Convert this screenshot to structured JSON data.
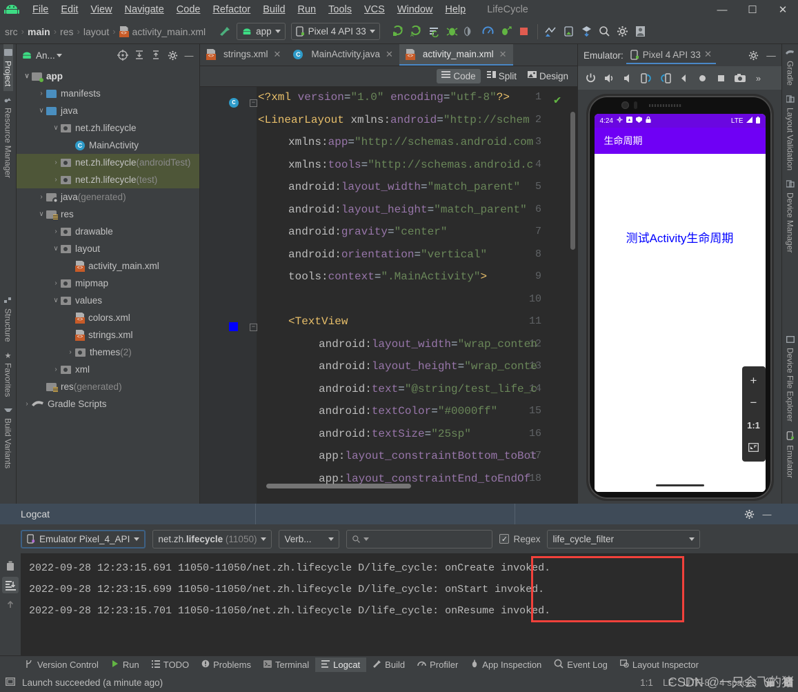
{
  "window": {
    "project_title": "LifeCycle",
    "minimize": "—",
    "maximize": "☐",
    "close": "✕"
  },
  "menu": {
    "items": [
      "File",
      "Edit",
      "View",
      "Navigate",
      "Code",
      "Refactor",
      "Build",
      "Run",
      "Tools",
      "VCS",
      "Window",
      "Help"
    ]
  },
  "navbar": {
    "breadcrumbs": [
      "src",
      "main",
      "res",
      "layout",
      "activity_main.xml"
    ],
    "separator": "›",
    "run_config": "app",
    "device": "Pixel 4 API 33",
    "icons": [
      "run-icon",
      "debug-run-icon",
      "apply-changes-icon",
      "debug-icon",
      "run-step-icon",
      "profiler-icon",
      "attach-debugger-icon",
      "stop-icon",
      "sdk-manager-icon",
      "avd-manager-icon",
      "sync-gradle-icon",
      "search-icon",
      "settings-icon",
      "account-icon"
    ]
  },
  "left_rail": {
    "items": [
      {
        "label": "Project",
        "icon": "project-icon",
        "selected": true
      },
      {
        "label": "Resource Manager",
        "icon": "resource-icon",
        "selected": false
      },
      {
        "label": "Structure",
        "icon": "structure-icon",
        "selected": false
      },
      {
        "label": "Favorites",
        "icon": "star-icon",
        "selected": false
      },
      {
        "label": "Build Variants",
        "icon": "variants-icon",
        "selected": false
      }
    ]
  },
  "right_rail": {
    "items": [
      {
        "label": "Gradle",
        "icon": "gradle-icon"
      },
      {
        "label": "Layout Validation",
        "icon": "layout-validation-icon"
      },
      {
        "label": "Device Manager",
        "icon": "device-manager-icon"
      },
      {
        "label": "Device File Explorer",
        "icon": "device-file-explorer-icon"
      },
      {
        "label": "Emulator",
        "icon": "emulator-icon"
      }
    ]
  },
  "project_panel": {
    "title": "An...",
    "tree": [
      {
        "indent": 0,
        "arrow": "∨",
        "icon": "folder-module",
        "label": "app",
        "suffix": "",
        "bold": true,
        "highlight": false
      },
      {
        "indent": 1,
        "arrow": "›",
        "icon": "folder-blue",
        "label": "manifests",
        "suffix": "",
        "bold": false,
        "highlight": false
      },
      {
        "indent": 1,
        "arrow": "∨",
        "icon": "folder-blue",
        "label": "java",
        "suffix": "",
        "bold": false,
        "highlight": false
      },
      {
        "indent": 2,
        "arrow": "∨",
        "icon": "package",
        "label": "net.zh.lifecycle",
        "suffix": "",
        "bold": false,
        "highlight": false
      },
      {
        "indent": 3,
        "arrow": "",
        "icon": "class",
        "label": "MainActivity",
        "suffix": "",
        "bold": false,
        "highlight": false
      },
      {
        "indent": 2,
        "arrow": "›",
        "icon": "package",
        "label": "net.zh.lifecycle",
        "suffix": " (androidTest)",
        "bold": false,
        "highlight": true
      },
      {
        "indent": 2,
        "arrow": "›",
        "icon": "package",
        "label": "net.zh.lifecycle",
        "suffix": " (test)",
        "bold": false,
        "highlight": true
      },
      {
        "indent": 1,
        "arrow": "›",
        "icon": "folder-generated",
        "label": "java",
        "suffix": " (generated)",
        "bold": false,
        "highlight": false
      },
      {
        "indent": 1,
        "arrow": "∨",
        "icon": "folder-res",
        "label": "res",
        "suffix": "",
        "bold": false,
        "highlight": false
      },
      {
        "indent": 2,
        "arrow": "›",
        "icon": "package",
        "label": "drawable",
        "suffix": "",
        "bold": false,
        "highlight": false
      },
      {
        "indent": 2,
        "arrow": "∨",
        "icon": "package",
        "label": "layout",
        "suffix": "",
        "bold": false,
        "highlight": false
      },
      {
        "indent": 3,
        "arrow": "",
        "icon": "xml-file",
        "label": "activity_main.xml",
        "suffix": "",
        "bold": false,
        "highlight": false
      },
      {
        "indent": 2,
        "arrow": "›",
        "icon": "package",
        "label": "mipmap",
        "suffix": "",
        "bold": false,
        "highlight": false
      },
      {
        "indent": 2,
        "arrow": "∨",
        "icon": "package",
        "label": "values",
        "suffix": "",
        "bold": false,
        "highlight": false
      },
      {
        "indent": 3,
        "arrow": "",
        "icon": "xml-file",
        "label": "colors.xml",
        "suffix": "",
        "bold": false,
        "highlight": false
      },
      {
        "indent": 3,
        "arrow": "",
        "icon": "xml-file",
        "label": "strings.xml",
        "suffix": "",
        "bold": false,
        "highlight": false
      },
      {
        "indent": 3,
        "arrow": "›",
        "icon": "package",
        "label": "themes",
        "suffix": " (2)",
        "bold": false,
        "highlight": false
      },
      {
        "indent": 2,
        "arrow": "›",
        "icon": "package",
        "label": "xml",
        "suffix": "",
        "bold": false,
        "highlight": false
      },
      {
        "indent": 1,
        "arrow": "",
        "icon": "folder-res",
        "label": "res",
        "suffix": " (generated)",
        "bold": false,
        "highlight": false
      },
      {
        "indent": 0,
        "arrow": "›",
        "icon": "gradle",
        "label": "Gradle Scripts",
        "suffix": "",
        "bold": false,
        "highlight": false
      }
    ]
  },
  "editor": {
    "tabs": [
      {
        "label": "strings.xml",
        "icon": "xml-file-icon",
        "active": false
      },
      {
        "label": "MainActivity.java",
        "icon": "java-class-icon",
        "active": false
      },
      {
        "label": "activity_main.xml",
        "icon": "xml-file-icon",
        "active": true
      }
    ],
    "modes": [
      {
        "label": "Code",
        "selected": true
      },
      {
        "label": "Split",
        "selected": false
      },
      {
        "label": "Design",
        "selected": false
      }
    ],
    "lines": [
      {
        "n": "1",
        "html": "<span class='k-tag'>&lt;?xml</span> <span class='k-attr'>version</span><span class='k-plain'>=</span><span class='k-str'>\"1.0\"</span> <span class='k-attr'>encoding</span><span class='k-plain'>=</span><span class='k-str'>\"utf-8\"</span><span class='k-tag'>?&gt;</span>",
        "indent": 0
      },
      {
        "n": "2",
        "html": "<span class='k-tag'>&lt;LinearLayout</span> <span class='k-ns'>xmlns:</span><span class='k-attr'>android</span><span class='k-plain'>=</span><span class='k-str'>\"http://schem</span>",
        "indent": 0
      },
      {
        "n": "3",
        "html": "<span class='k-ns'>xmlns:</span><span class='k-attr'>app</span><span class='k-plain'>=</span><span class='k-str'>\"http://schemas.android.com</span>",
        "indent": 1
      },
      {
        "n": "4",
        "html": "<span class='k-ns'>xmlns:</span><span class='k-attr'>tools</span><span class='k-plain'>=</span><span class='k-str'>\"http://schemas.android.c</span>",
        "indent": 1
      },
      {
        "n": "5",
        "html": "<span class='k-ns'>android:</span><span class='k-attr'>layout_width</span><span class='k-plain'>=</span><span class='k-str'>\"match_parent\"</span>",
        "indent": 1
      },
      {
        "n": "6",
        "html": "<span class='k-ns'>android:</span><span class='k-attr'>layout_height</span><span class='k-plain'>=</span><span class='k-str'>\"match_parent\"</span>",
        "indent": 1
      },
      {
        "n": "7",
        "html": "<span class='k-ns'>android:</span><span class='k-attr'>gravity</span><span class='k-plain'>=</span><span class='k-str'>\"center\"</span>",
        "indent": 1
      },
      {
        "n": "8",
        "html": "<span class='k-ns'>android:</span><span class='k-attr'>orientation</span><span class='k-plain'>=</span><span class='k-str'>\"vertical\"</span>",
        "indent": 1
      },
      {
        "n": "9",
        "html": "<span class='k-ns'>tools:</span><span class='k-attr'>context</span><span class='k-plain'>=</span><span class='k-str'>\".MainActivity\"</span><span class='k-tag'>&gt;</span>",
        "indent": 1
      },
      {
        "n": "10",
        "html": "",
        "indent": 0
      },
      {
        "n": "11",
        "html": "<span class='k-tag'>&lt;TextView</span>",
        "indent": 1
      },
      {
        "n": "12",
        "html": "<span class='k-ns'>android:</span><span class='k-attr'>layout_width</span><span class='k-plain'>=</span><span class='k-str'>\"wrap_conten</span>",
        "indent": 2
      },
      {
        "n": "13",
        "html": "<span class='k-ns'>android:</span><span class='k-attr'>layout_height</span><span class='k-plain'>=</span><span class='k-str'>\"wrap_conte</span>",
        "indent": 2
      },
      {
        "n": "14",
        "html": "<span class='k-ns'>android:</span><span class='k-attr'>text</span><span class='k-plain'>=</span><span class='k-str'>\"@string/test_life_c</span>",
        "indent": 2
      },
      {
        "n": "15",
        "html": "<span class='k-ns'>android:</span><span class='k-attr'>textColor</span><span class='k-plain'>=</span><span class='k-str'>\"#0000ff\"</span>",
        "indent": 2
      },
      {
        "n": "16",
        "html": "<span class='k-ns'>android:</span><span class='k-attr'>textSize</span><span class='k-plain'>=</span><span class='k-str'>\"25sp\"</span>",
        "indent": 2
      },
      {
        "n": "17",
        "html": "<span class='k-ns'>app:</span><span class='k-attr'>layout_constraintBottom_toBot</span>",
        "indent": 2
      },
      {
        "n": "18",
        "html": "<span class='k-ns'>app:</span><span class='k-attr'>layout_constraintEnd_toEndOf</span>",
        "indent": 2
      }
    ]
  },
  "emulator": {
    "label": "Emulator:",
    "tab": "Pixel 4 API 33",
    "toolbar_icons": [
      "power-icon",
      "volume-up-icon",
      "volume-down-icon",
      "rotate-left-icon",
      "rotate-right-icon",
      "back-icon",
      "home-icon",
      "overview-icon",
      "screenshot-icon",
      "more-icon"
    ],
    "device": {
      "status_time": "4:24",
      "status_right": "LTE",
      "app_bar_title": "生命周期",
      "screen_text": "测试Activity生命周期",
      "screen_text_color": "#0000ff",
      "app_bar_color": "#6f00f5"
    },
    "zoom_controls": [
      "+",
      "−",
      "1:1",
      "⛶"
    ]
  },
  "logcat": {
    "title": "Logcat",
    "device_filter": "Emulator Pixel_4_API",
    "process_filter_prefix": "net.zh.",
    "process_filter_bold": "lifecycle",
    "process_filter_pid": "(11050)",
    "level_filter": "Verb...",
    "search_placeholder": "",
    "regex_label": "Regex",
    "regex_checked": true,
    "named_filter": "life_cycle_filter",
    "rail_icons": [
      "trash-icon",
      "scroll-to-end-icon",
      "up-arrow-icon"
    ],
    "lines": [
      {
        "prefix": "2022-09-28 12:23:15.691 11050-11050/net.zh.lifecycle D/life_cycle:",
        "message": "onCreate invoked."
      },
      {
        "prefix": "2022-09-28 12:23:15.699 11050-11050/net.zh.lifecycle D/life_cycle:",
        "message": "onStart invoked."
      },
      {
        "prefix": "2022-09-28 12:23:15.701 11050-11050/net.zh.lifecycle D/life_cycle:",
        "message": "onResume invoked."
      }
    ],
    "highlight_color": "#f2413b"
  },
  "tool_windows": {
    "items": [
      {
        "label": "Version Control",
        "icon": "vcs-icon",
        "selected": false
      },
      {
        "label": "Run",
        "icon": "run-icon",
        "selected": false
      },
      {
        "label": "TODO",
        "icon": "todo-icon",
        "selected": false
      },
      {
        "label": "Problems",
        "icon": "problems-icon",
        "selected": false
      },
      {
        "label": "Terminal",
        "icon": "terminal-icon",
        "selected": false
      },
      {
        "label": "Logcat",
        "icon": "logcat-icon",
        "selected": true
      },
      {
        "label": "Build",
        "icon": "build-icon",
        "selected": false
      },
      {
        "label": "Profiler",
        "icon": "profiler-icon",
        "selected": false
      },
      {
        "label": "App Inspection",
        "icon": "app-inspection-icon",
        "selected": false
      },
      {
        "label": "Event Log",
        "icon": "event-log-icon",
        "selected": false
      },
      {
        "label": "Layout Inspector",
        "icon": "layout-inspector-icon",
        "selected": false
      }
    ]
  },
  "status_bar": {
    "message": "Launch succeeded (a minute ago)",
    "caret": "1:1",
    "line_sep": "LF",
    "encoding": "UTF-8",
    "indent": "4 spaces"
  },
  "watermark": "CSDN @一只会飞的猪"
}
